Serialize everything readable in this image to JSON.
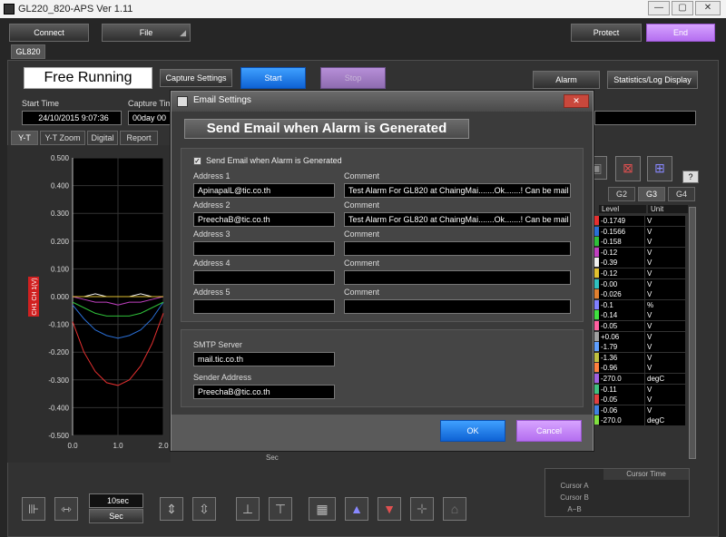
{
  "window": {
    "title": "GL220_820-APS Ver 1.11",
    "min": "—",
    "max": "▢",
    "close": "✕"
  },
  "toolbar": {
    "connect": "Connect",
    "file": "File",
    "protect": "Protect",
    "end": "End"
  },
  "device_tab": "GL820",
  "status": {
    "mode": "Free Running",
    "capture_settings": "Capture Settings",
    "start": "Start",
    "stop": "Stop",
    "alarm": "Alarm",
    "stats": "Statistics/Log Display"
  },
  "times": {
    "start_label": "Start Time",
    "start_value": "24/10/2015 9:07:36",
    "capture_label": "Capture Tim",
    "capture_value": "00day 00"
  },
  "view_tabs": [
    "Y-T",
    "Y-T Zoom",
    "Digital",
    "Report"
  ],
  "chart_data": {
    "type": "line",
    "ylabel": "CH1  CH 1(V)",
    "xlabel": "Sec",
    "yticks": [
      "0.500",
      "0.400",
      "0.300",
      "0.200",
      "0.100",
      "0.000",
      "-0.100",
      "-0.200",
      "-0.300",
      "-0.400",
      "-0.500"
    ],
    "xticks": [
      "0.0",
      "1.0",
      "2.0"
    ],
    "ylim": [
      -0.5,
      0.5
    ],
    "xlim": [
      0,
      2.0
    ],
    "grid": true,
    "series": [
      {
        "color": "#e53030",
        "x": [
          0,
          0.25,
          0.5,
          0.75,
          1.0,
          1.25,
          1.5,
          1.75,
          2.0
        ],
        "y": [
          -0.09,
          -0.2,
          -0.27,
          -0.31,
          -0.32,
          -0.3,
          -0.25,
          -0.17,
          -0.06
        ]
      },
      {
        "color": "#2a6fd6",
        "x": [
          0,
          0.25,
          0.5,
          0.75,
          1.0,
          1.25,
          1.5,
          1.75,
          2.0
        ],
        "y": [
          -0.03,
          -0.08,
          -0.12,
          -0.14,
          -0.15,
          -0.14,
          -0.12,
          -0.08,
          -0.02
        ]
      },
      {
        "color": "#2fbf3a",
        "x": [
          0,
          0.25,
          0.5,
          0.75,
          1.0,
          1.25,
          1.5,
          1.75,
          2.0
        ],
        "y": [
          -0.02,
          -0.04,
          -0.06,
          -0.07,
          -0.07,
          -0.07,
          -0.06,
          -0.04,
          -0.02
        ]
      },
      {
        "color": "#c040c0",
        "x": [
          0,
          0.25,
          0.5,
          0.75,
          1.0,
          1.25,
          1.5,
          1.75,
          2.0
        ],
        "y": [
          0.0,
          -0.01,
          -0.02,
          -0.02,
          -0.03,
          -0.02,
          -0.02,
          -0.01,
          0.0
        ]
      },
      {
        "color": "#f0f0f0",
        "x": [
          0,
          0.25,
          0.5,
          0.75,
          1.0,
          1.25,
          1.5,
          1.75,
          2.0
        ],
        "y": [
          0.0,
          0.0,
          0.01,
          0.0,
          0.0,
          0.0,
          0.01,
          0.0,
          0.0
        ]
      },
      {
        "color": "#e0c030",
        "x": [
          0,
          0.25,
          0.5,
          0.75,
          1.0,
          1.25,
          1.5,
          1.75,
          2.0
        ],
        "y": [
          0.0,
          0.0,
          0.0,
          0.0,
          0.0,
          0.0,
          0.0,
          0.0,
          0.0
        ]
      }
    ]
  },
  "bottom": {
    "time_div": "10sec",
    "unit": "Sec"
  },
  "groups": [
    "G2",
    "G3",
    "G4"
  ],
  "help": "?",
  "table": {
    "h_level": "Level",
    "h_unit": "Unit",
    "rows": [
      {
        "level": "-0.1749",
        "unit": "V",
        "color": "#e53030"
      },
      {
        "level": "-0.1566",
        "unit": "V",
        "color": "#2a6fd6"
      },
      {
        "level": "-0.158",
        "unit": "V",
        "color": "#2fbf3a"
      },
      {
        "level": "-0.12",
        "unit": "V",
        "color": "#c040c0"
      },
      {
        "level": "-0.39",
        "unit": "V",
        "color": "#f0f0f0"
      },
      {
        "level": "-0.12",
        "unit": "V",
        "color": "#e0c030"
      },
      {
        "level": "-0.00",
        "unit": "V",
        "color": "#30c0c0"
      },
      {
        "level": "-0.026",
        "unit": "V",
        "color": "#e08030"
      },
      {
        "level": "-0.1",
        "unit": "%",
        "color": "#8080ff"
      },
      {
        "level": "-0.14",
        "unit": "V",
        "color": "#40e040"
      },
      {
        "level": "-0.05",
        "unit": "V",
        "color": "#ff60a0"
      },
      {
        "level": "+0.06",
        "unit": "V",
        "color": "#a0a0a0"
      },
      {
        "level": "-1.79",
        "unit": "V",
        "color": "#60a0ff"
      },
      {
        "level": "-1.36",
        "unit": "V",
        "color": "#c0c040"
      },
      {
        "level": "-0.96",
        "unit": "V",
        "color": "#ff8040"
      },
      {
        "level": "-270.0",
        "unit": "degC",
        "color": "#a060e0"
      },
      {
        "level": "-0.11",
        "unit": "V",
        "color": "#40c080"
      },
      {
        "level": "-0.05",
        "unit": "V",
        "color": "#e04040"
      },
      {
        "level": "-0.06",
        "unit": "V",
        "color": "#4080e0"
      },
      {
        "level": "-270.0",
        "unit": "degC",
        "color": "#80e040"
      }
    ]
  },
  "cursor": {
    "title": "Cursor Time",
    "a": "Cursor A",
    "b": "Cursor B",
    "ab": "A−B"
  },
  "dialog": {
    "title": "Email Settings",
    "heading": "Send Email when Alarm is Generated",
    "checkbox_label": "Send Email when Alarm is Generated",
    "addresses": [
      {
        "label": "Address 1",
        "value": "ApinapalL@tic.co.th",
        "comment_label": "Comment",
        "comment": "Test Alarm For GL820 at ChaingMai.......Ok.......! Can be mail"
      },
      {
        "label": "Address 2",
        "value": "PreechaB@tic.co.th",
        "comment_label": "Comment",
        "comment": "Test Alarm For GL820 at ChaingMai.......Ok.......! Can be mail"
      },
      {
        "label": "Address 3",
        "value": "",
        "comment_label": "Comment",
        "comment": ""
      },
      {
        "label": "Address 4",
        "value": "",
        "comment_label": "Comment",
        "comment": ""
      },
      {
        "label": "Address 5",
        "value": "",
        "comment_label": "Comment",
        "comment": ""
      }
    ],
    "smtp_label": "SMTP Server",
    "smtp": "mail.tic.co.th",
    "sender_label": "Sender Address",
    "sender": "PreechaB@tic.co.th",
    "ok": "OK",
    "cancel": "Cancel"
  }
}
